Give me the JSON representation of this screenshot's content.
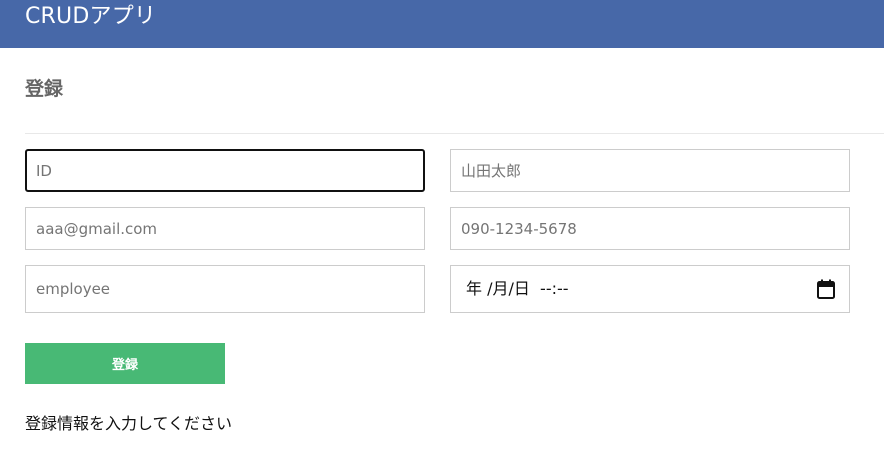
{
  "header": {
    "app_title": "CRUDアプリ",
    "background_color": "#4768a8"
  },
  "page": {
    "title": "登録"
  },
  "form": {
    "id_field": {
      "placeholder": "ID",
      "value": ""
    },
    "name_field": {
      "placeholder": "山田太郎",
      "value": ""
    },
    "email_field": {
      "placeholder": "aaa@gmail.com",
      "value": ""
    },
    "phone_field": {
      "placeholder": "090-1234-5678",
      "value": ""
    },
    "role_field": {
      "placeholder": "employee",
      "value": ""
    },
    "datetime_field": {
      "display": "年 /月/日  --:--",
      "icon": "calendar-icon"
    },
    "submit_label": "登録",
    "submit_color": "#48b975"
  },
  "message": {
    "text": "登録情報を入力してください"
  }
}
